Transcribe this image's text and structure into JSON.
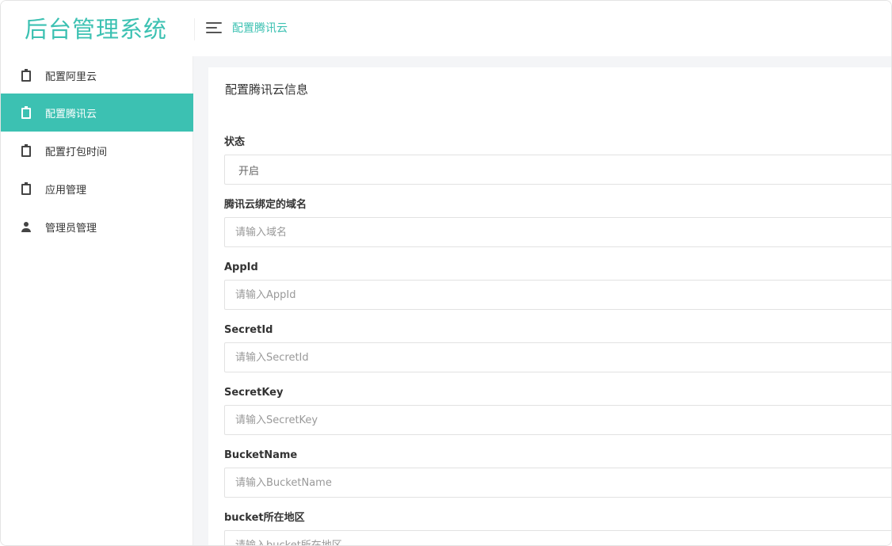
{
  "header": {
    "logo": "后台管理系统",
    "breadcrumb": "配置腾讯云"
  },
  "sidebar": {
    "items": [
      {
        "label": "配置阿里云",
        "icon": "clipboard-icon",
        "active": false
      },
      {
        "label": "配置腾讯云",
        "icon": "clipboard-icon",
        "active": true
      },
      {
        "label": "配置打包时间",
        "icon": "clipboard-icon",
        "active": false
      },
      {
        "label": "应用管理",
        "icon": "clipboard-icon",
        "active": false
      },
      {
        "label": "管理员管理",
        "icon": "user-icon",
        "active": false
      }
    ]
  },
  "form": {
    "title": "配置腾讯云信息",
    "fields": [
      {
        "label": "状态",
        "value": "开启",
        "placeholder": ""
      },
      {
        "label": "腾讯云绑定的域名",
        "value": "",
        "placeholder": "请输入域名"
      },
      {
        "label": "AppId",
        "value": "",
        "placeholder": "请输入AppId"
      },
      {
        "label": "SecretId",
        "value": "",
        "placeholder": "请输入SecretId"
      },
      {
        "label": "SecretKey",
        "value": "",
        "placeholder": "请输入SecretKey"
      },
      {
        "label": "BucketName",
        "value": "",
        "placeholder": "请输入BucketName"
      },
      {
        "label": "bucket所在地区",
        "value": "",
        "placeholder": "请输入bucket所在地区"
      }
    ]
  },
  "colors": {
    "accent": "#3cc1b2",
    "background": "#f4f5f7"
  }
}
